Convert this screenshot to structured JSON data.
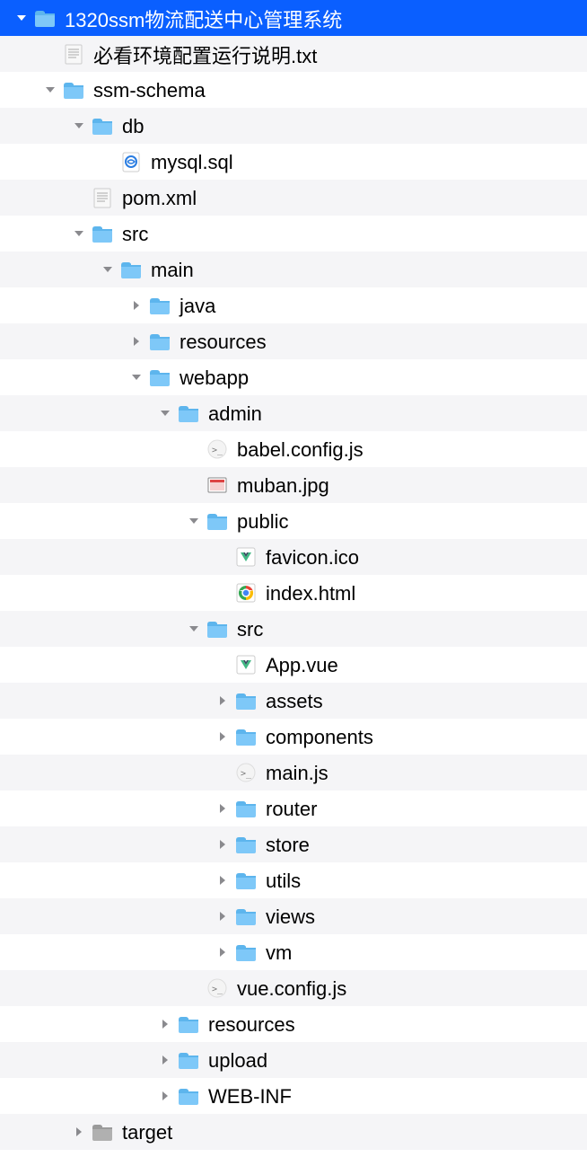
{
  "indentUnit": 32,
  "baseIndent": 14,
  "rows": [
    {
      "depth": 0,
      "chev": "down",
      "icon": "folder",
      "label": "1320ssm物流配送中心管理系统",
      "selected": true
    },
    {
      "depth": 1,
      "chev": "none",
      "icon": "txt",
      "label": "必看环境配置运行说明.txt",
      "selected": false
    },
    {
      "depth": 1,
      "chev": "down",
      "icon": "folder",
      "label": "ssm-schema",
      "selected": false
    },
    {
      "depth": 2,
      "chev": "down",
      "icon": "folder",
      "label": "db",
      "selected": false
    },
    {
      "depth": 3,
      "chev": "none",
      "icon": "sql",
      "label": "mysql.sql",
      "selected": false
    },
    {
      "depth": 2,
      "chev": "none",
      "icon": "txt",
      "label": "pom.xml",
      "selected": false
    },
    {
      "depth": 2,
      "chev": "down",
      "icon": "folder",
      "label": "src",
      "selected": false
    },
    {
      "depth": 3,
      "chev": "down",
      "icon": "folder",
      "label": "main",
      "selected": false
    },
    {
      "depth": 4,
      "chev": "right",
      "icon": "folder",
      "label": "java",
      "selected": false
    },
    {
      "depth": 4,
      "chev": "right",
      "icon": "folder",
      "label": "resources",
      "selected": false
    },
    {
      "depth": 4,
      "chev": "down",
      "icon": "folder",
      "label": "webapp",
      "selected": false
    },
    {
      "depth": 5,
      "chev": "down",
      "icon": "folder",
      "label": "admin",
      "selected": false
    },
    {
      "depth": 6,
      "chev": "none",
      "icon": "js",
      "label": "babel.config.js",
      "selected": false
    },
    {
      "depth": 6,
      "chev": "none",
      "icon": "img",
      "label": "muban.jpg",
      "selected": false
    },
    {
      "depth": 6,
      "chev": "down",
      "icon": "folder",
      "label": "public",
      "selected": false
    },
    {
      "depth": 7,
      "chev": "none",
      "icon": "vue",
      "label": "favicon.ico",
      "selected": false
    },
    {
      "depth": 7,
      "chev": "none",
      "icon": "chrome",
      "label": "index.html",
      "selected": false
    },
    {
      "depth": 6,
      "chev": "down",
      "icon": "folder",
      "label": "src",
      "selected": false
    },
    {
      "depth": 7,
      "chev": "none",
      "icon": "vue",
      "label": "App.vue",
      "selected": false
    },
    {
      "depth": 7,
      "chev": "right",
      "icon": "folder",
      "label": "assets",
      "selected": false
    },
    {
      "depth": 7,
      "chev": "right",
      "icon": "folder",
      "label": "components",
      "selected": false
    },
    {
      "depth": 7,
      "chev": "none",
      "icon": "js",
      "label": "main.js",
      "selected": false
    },
    {
      "depth": 7,
      "chev": "right",
      "icon": "folder",
      "label": "router",
      "selected": false
    },
    {
      "depth": 7,
      "chev": "right",
      "icon": "folder",
      "label": "store",
      "selected": false
    },
    {
      "depth": 7,
      "chev": "right",
      "icon": "folder",
      "label": "utils",
      "selected": false
    },
    {
      "depth": 7,
      "chev": "right",
      "icon": "folder",
      "label": "views",
      "selected": false
    },
    {
      "depth": 7,
      "chev": "right",
      "icon": "folder",
      "label": "vm",
      "selected": false
    },
    {
      "depth": 6,
      "chev": "none",
      "icon": "js",
      "label": "vue.config.js",
      "selected": false
    },
    {
      "depth": 5,
      "chev": "right",
      "icon": "folder",
      "label": "resources",
      "selected": false
    },
    {
      "depth": 5,
      "chev": "right",
      "icon": "folder",
      "label": "upload",
      "selected": false
    },
    {
      "depth": 5,
      "chev": "right",
      "icon": "folder",
      "label": "WEB-INF",
      "selected": false
    },
    {
      "depth": 2,
      "chev": "right",
      "icon": "folder-gray",
      "label": "target",
      "selected": false
    }
  ]
}
